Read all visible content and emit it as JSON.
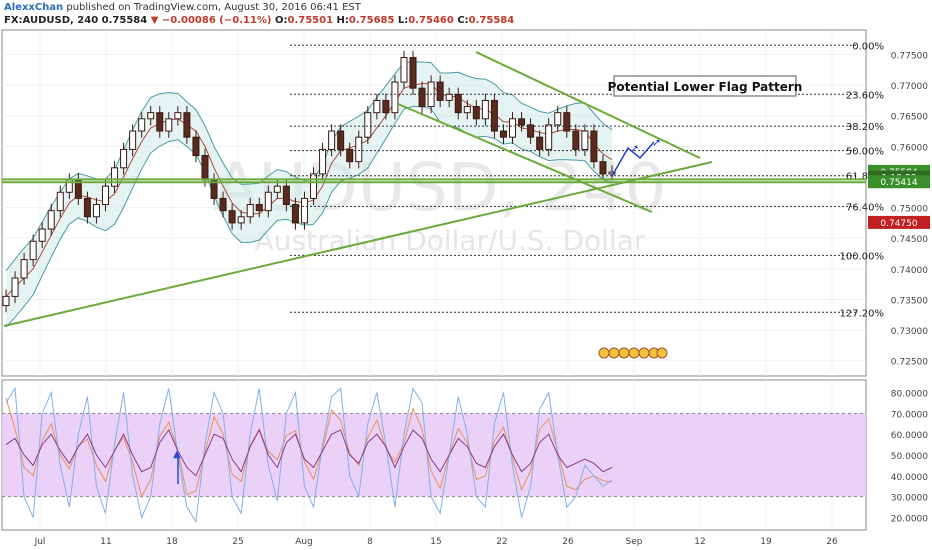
{
  "header": {
    "author": "AlexxChan",
    "published": "published on TradingView.com, August 30, 2016 06:41 EST",
    "symbol": "FX:AUDUSD, 240",
    "last": "0.75584",
    "change_arrow": "▼",
    "change": "−0.00086 (−0.11%)",
    "open_label": "O:",
    "open": "0.75501",
    "high_label": "H:",
    "high": "0.75685",
    "low_label": "L:",
    "low": "0.75460",
    "close_label": "C:",
    "close": "0.75584"
  },
  "colors": {
    "up_candle": "#ffffff",
    "down_candle": "#5a2a1e",
    "bollinger": "#4a9aa8",
    "bollinger_fill": "#cfe9ea",
    "trendline": "#6aaa3a",
    "fib_line": "#333333",
    "rsi_band": "#e6c6f5",
    "stoch_k": "#7fb0e6",
    "stoch_d": "#e8925a",
    "rsi_line": "#8a3a8a",
    "price_badge": "#3b8f2a",
    "projection": "#1f3fd0"
  },
  "chart_data": [
    {
      "type": "candlestick",
      "symbol": "FX:AUDUSD",
      "timeframe": "240",
      "watermark_main": "AUDUSD, 240",
      "watermark_sub": "Australian Dollar/U.S. Dollar",
      "x_ticks": [
        "Jul",
        "11",
        "18",
        "25",
        "Aug",
        "8",
        "15",
        "22",
        "26",
        "Sep",
        "12",
        "19",
        "26"
      ],
      "y_ticks": [
        "0.72500",
        "0.73000",
        "0.73500",
        "0.74000",
        "0.74500",
        "0.75000",
        "0.75500",
        "0.76000",
        "0.76500",
        "0.77000",
        "0.77500"
      ],
      "ylim": [
        0.7225,
        0.779
      ],
      "price_series": [
        0.7355,
        0.7385,
        0.7415,
        0.7445,
        0.7465,
        0.7495,
        0.7525,
        0.7545,
        0.7515,
        0.7485,
        0.7505,
        0.7535,
        0.7565,
        0.7595,
        0.7625,
        0.7645,
        0.7655,
        0.7625,
        0.7645,
        0.7655,
        0.7615,
        0.7585,
        0.7545,
        0.7515,
        0.7495,
        0.7475,
        0.7485,
        0.7505,
        0.7495,
        0.7525,
        0.7535,
        0.7505,
        0.7475,
        0.7515,
        0.7555,
        0.7595,
        0.7625,
        0.7595,
        0.7575,
        0.7615,
        0.7655,
        0.7675,
        0.7655,
        0.7705,
        0.7745,
        0.7695,
        0.7665,
        0.7705,
        0.7675,
        0.7685,
        0.7655,
        0.7665,
        0.7645,
        0.7675,
        0.7625,
        0.7615,
        0.7645,
        0.7635,
        0.7615,
        0.7595,
        0.7635,
        0.7655,
        0.7625,
        0.7595,
        0.7625,
        0.7575,
        0.7555,
        0.7558
      ],
      "fib_levels": [
        {
          "label": "0.00%",
          "price": 0.7765
        },
        {
          "label": "23.60%",
          "price": 0.7685
        },
        {
          "label": "38.20%",
          "price": 0.7633
        },
        {
          "label": "50.00%",
          "price": 0.7593
        },
        {
          "label": "61.80%",
          "price": 0.7552
        },
        {
          "label": "76.40%",
          "price": 0.7502
        },
        {
          "label": "100.00%",
          "price": 0.7422
        },
        {
          "label": "127.20%",
          "price": 0.7329
        }
      ],
      "horizontal_levels": [
        0.7546,
        0.75414
      ],
      "price_labels": [
        {
          "text": "0.75584",
          "price": 0.75584
        },
        {
          "text": "1:18:38",
          "price": 0.7549
        },
        {
          "text": "0.75414",
          "price": 0.75414
        },
        {
          "text": "0.74750",
          "price": 0.7475
        }
      ],
      "annotation": "Potential Lower Flag Pattern"
    },
    {
      "type": "line",
      "name": "oscillator",
      "y_ticks": [
        "20.0000",
        "30.0000",
        "40.0000",
        "50.0000",
        "60.0000",
        "70.0000",
        "80.0000"
      ],
      "ylim": [
        14,
        86
      ],
      "band": [
        30,
        70
      ],
      "stoch_k": [
        75,
        82,
        30,
        20,
        70,
        80,
        45,
        25,
        60,
        78,
        35,
        22,
        55,
        80,
        40,
        20,
        30,
        65,
        82,
        50,
        25,
        18,
        55,
        80,
        70,
        30,
        22,
        60,
        82,
        45,
        28,
        70,
        80,
        35,
        25,
        55,
        78,
        82,
        40,
        30,
        65,
        80,
        55,
        25,
        60,
        82,
        75,
        30,
        22,
        50,
        78,
        60,
        30,
        25,
        65,
        80,
        45,
        20,
        35,
        72,
        80,
        50,
        25,
        30,
        45,
        40,
        35,
        38
      ],
      "rsi": [
        55,
        58,
        50,
        45,
        55,
        60,
        52,
        46,
        54,
        60,
        50,
        44,
        52,
        60,
        50,
        42,
        44,
        56,
        62,
        52,
        44,
        40,
        50,
        60,
        58,
        48,
        42,
        54,
        62,
        50,
        44,
        56,
        60,
        48,
        44,
        52,
        60,
        62,
        50,
        46,
        56,
        60,
        54,
        44,
        54,
        62,
        58,
        48,
        42,
        50,
        58,
        54,
        46,
        44,
        54,
        60,
        50,
        42,
        46,
        56,
        60,
        50,
        44,
        46,
        48,
        46,
        42,
        44
      ]
    }
  ]
}
